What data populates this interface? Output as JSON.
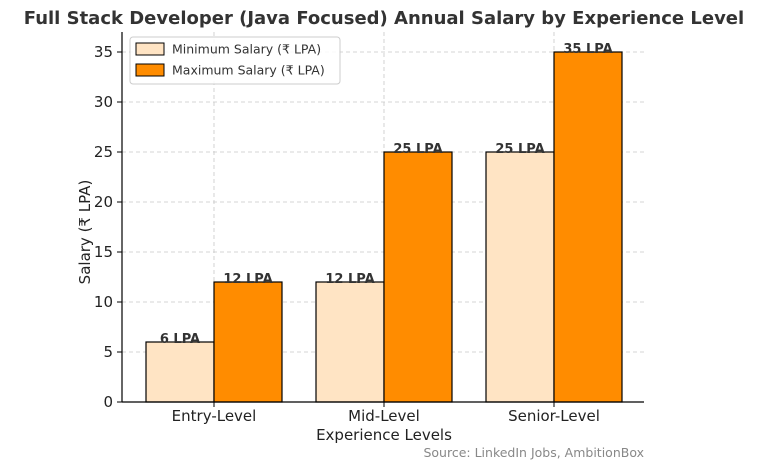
{
  "chart_data": {
    "type": "bar",
    "title": "Full Stack Developer (Java Focused) Annual Salary by Experience Level",
    "xlabel": "Experience Levels",
    "ylabel": "Salary (₹ LPA)",
    "categories": [
      "Entry-Level",
      "Mid-Level",
      "Senior-Level"
    ],
    "series": [
      {
        "name": "Minimum Salary (₹ LPA)",
        "values": [
          6,
          12,
          25
        ],
        "labels": [
          "6 LPA",
          "12 LPA",
          "25 LPA"
        ],
        "color": "#FFE4C4"
      },
      {
        "name": "Maximum Salary (₹ LPA)",
        "values": [
          12,
          25,
          35
        ],
        "labels": [
          "12 LPA",
          "25 LPA",
          "35 LPA"
        ],
        "color": "#FF8C00"
      }
    ],
    "ylim": [
      0,
      37
    ],
    "yticks": [
      0,
      5,
      10,
      15,
      20,
      25,
      30,
      35
    ],
    "grid": true,
    "legend_position": "top-left",
    "source": "Source: LinkedIn Jobs, AmbitionBox"
  }
}
